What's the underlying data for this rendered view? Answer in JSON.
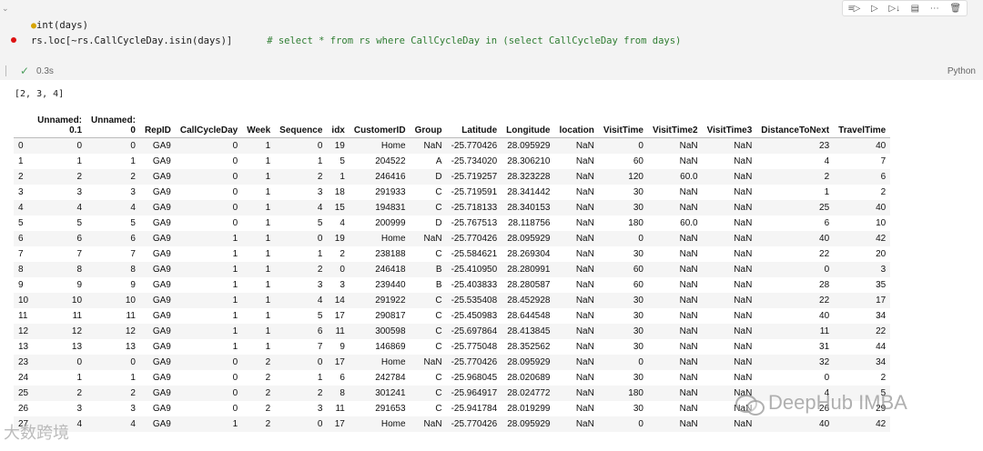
{
  "cell": {
    "code_line1": "int(days)",
    "code_line2_code": "rs.loc[~rs.CallCycleDay.isin(days)]",
    "code_line2_comment": "# select * from rs where CallCycleDay in (select CallCycleDay from days)",
    "exec_time": "0.3s",
    "language": "Python",
    "toolbar_icons": [
      "run-by-line-icon",
      "run-above-icon",
      "run-below-icon",
      "split-cell-icon",
      "more-icon",
      "delete-icon"
    ]
  },
  "output": {
    "printed": "[2, 3, 4]"
  },
  "table": {
    "columns": [
      "",
      "Unnamed:\n0.1",
      "Unnamed:\n0",
      "RepID",
      "CallCycleDay",
      "Week",
      "Sequence",
      "idx",
      "CustomerID",
      "Group",
      "Latitude",
      "Longitude",
      "location",
      "VisitTime",
      "VisitTime2",
      "VisitTime3",
      "DistanceToNext",
      "TravelTime"
    ],
    "rows": [
      [
        "0",
        "0",
        "0",
        "GA9",
        "0",
        "1",
        "0",
        "19",
        "Home",
        "NaN",
        "-25.770426",
        "28.095929",
        "NaN",
        "0",
        "NaN",
        "NaN",
        "23",
        "40"
      ],
      [
        "1",
        "1",
        "1",
        "GA9",
        "0",
        "1",
        "1",
        "5",
        "204522",
        "A",
        "-25.734020",
        "28.306210",
        "NaN",
        "60",
        "NaN",
        "NaN",
        "4",
        "7"
      ],
      [
        "2",
        "2",
        "2",
        "GA9",
        "0",
        "1",
        "2",
        "1",
        "246416",
        "D",
        "-25.719257",
        "28.323228",
        "NaN",
        "120",
        "60.0",
        "NaN",
        "2",
        "6"
      ],
      [
        "3",
        "3",
        "3",
        "GA9",
        "0",
        "1",
        "3",
        "18",
        "291933",
        "C",
        "-25.719591",
        "28.341442",
        "NaN",
        "30",
        "NaN",
        "NaN",
        "1",
        "2"
      ],
      [
        "4",
        "4",
        "4",
        "GA9",
        "0",
        "1",
        "4",
        "15",
        "194831",
        "C",
        "-25.718133",
        "28.340153",
        "NaN",
        "30",
        "NaN",
        "NaN",
        "25",
        "40"
      ],
      [
        "5",
        "5",
        "5",
        "GA9",
        "0",
        "1",
        "5",
        "4",
        "200999",
        "D",
        "-25.767513",
        "28.118756",
        "NaN",
        "180",
        "60.0",
        "NaN",
        "6",
        "10"
      ],
      [
        "6",
        "6",
        "6",
        "GA9",
        "1",
        "1",
        "0",
        "19",
        "Home",
        "NaN",
        "-25.770426",
        "28.095929",
        "NaN",
        "0",
        "NaN",
        "NaN",
        "40",
        "42"
      ],
      [
        "7",
        "7",
        "7",
        "GA9",
        "1",
        "1",
        "1",
        "2",
        "238188",
        "C",
        "-25.584621",
        "28.269304",
        "NaN",
        "30",
        "NaN",
        "NaN",
        "22",
        "20"
      ],
      [
        "8",
        "8",
        "8",
        "GA9",
        "1",
        "1",
        "2",
        "0",
        "246418",
        "B",
        "-25.410950",
        "28.280991",
        "NaN",
        "60",
        "NaN",
        "NaN",
        "0",
        "3"
      ],
      [
        "9",
        "9",
        "9",
        "GA9",
        "1",
        "1",
        "3",
        "3",
        "239440",
        "B",
        "-25.403833",
        "28.280587",
        "NaN",
        "60",
        "NaN",
        "NaN",
        "28",
        "35"
      ],
      [
        "10",
        "10",
        "10",
        "GA9",
        "1",
        "1",
        "4",
        "14",
        "291922",
        "C",
        "-25.535408",
        "28.452928",
        "NaN",
        "30",
        "NaN",
        "NaN",
        "22",
        "17"
      ],
      [
        "11",
        "11",
        "11",
        "GA9",
        "1",
        "1",
        "5",
        "17",
        "290817",
        "C",
        "-25.450983",
        "28.644548",
        "NaN",
        "30",
        "NaN",
        "NaN",
        "40",
        "34"
      ],
      [
        "12",
        "12",
        "12",
        "GA9",
        "1",
        "1",
        "6",
        "11",
        "300598",
        "C",
        "-25.697864",
        "28.413845",
        "NaN",
        "30",
        "NaN",
        "NaN",
        "11",
        "22"
      ],
      [
        "13",
        "13",
        "13",
        "GA9",
        "1",
        "1",
        "7",
        "9",
        "146869",
        "C",
        "-25.775048",
        "28.352562",
        "NaN",
        "30",
        "NaN",
        "NaN",
        "31",
        "44"
      ],
      [
        "23",
        "0",
        "0",
        "GA9",
        "0",
        "2",
        "0",
        "17",
        "Home",
        "NaN",
        "-25.770426",
        "28.095929",
        "NaN",
        "0",
        "NaN",
        "NaN",
        "32",
        "34"
      ],
      [
        "24",
        "1",
        "1",
        "GA9",
        "0",
        "2",
        "1",
        "6",
        "242784",
        "C",
        "-25.968045",
        "28.020689",
        "NaN",
        "30",
        "NaN",
        "NaN",
        "0",
        "2"
      ],
      [
        "25",
        "2",
        "2",
        "GA9",
        "0",
        "2",
        "2",
        "8",
        "301241",
        "C",
        "-25.964917",
        "28.024772",
        "NaN",
        "180",
        "NaN",
        "NaN",
        "4",
        "5"
      ],
      [
        "26",
        "3",
        "3",
        "GA9",
        "0",
        "2",
        "3",
        "11",
        "291653",
        "C",
        "-25.941784",
        "28.019299",
        "NaN",
        "30",
        "NaN",
        "NaN",
        "26",
        "29"
      ],
      [
        "27",
        "4",
        "4",
        "GA9",
        "1",
        "2",
        "0",
        "17",
        "Home",
        "NaN",
        "-25.770426",
        "28.095929",
        "NaN",
        "0",
        "NaN",
        "NaN",
        "40",
        "42"
      ]
    ]
  },
  "watermarks": {
    "right": "DeepHub IMBA",
    "left": "大数跨境"
  }
}
